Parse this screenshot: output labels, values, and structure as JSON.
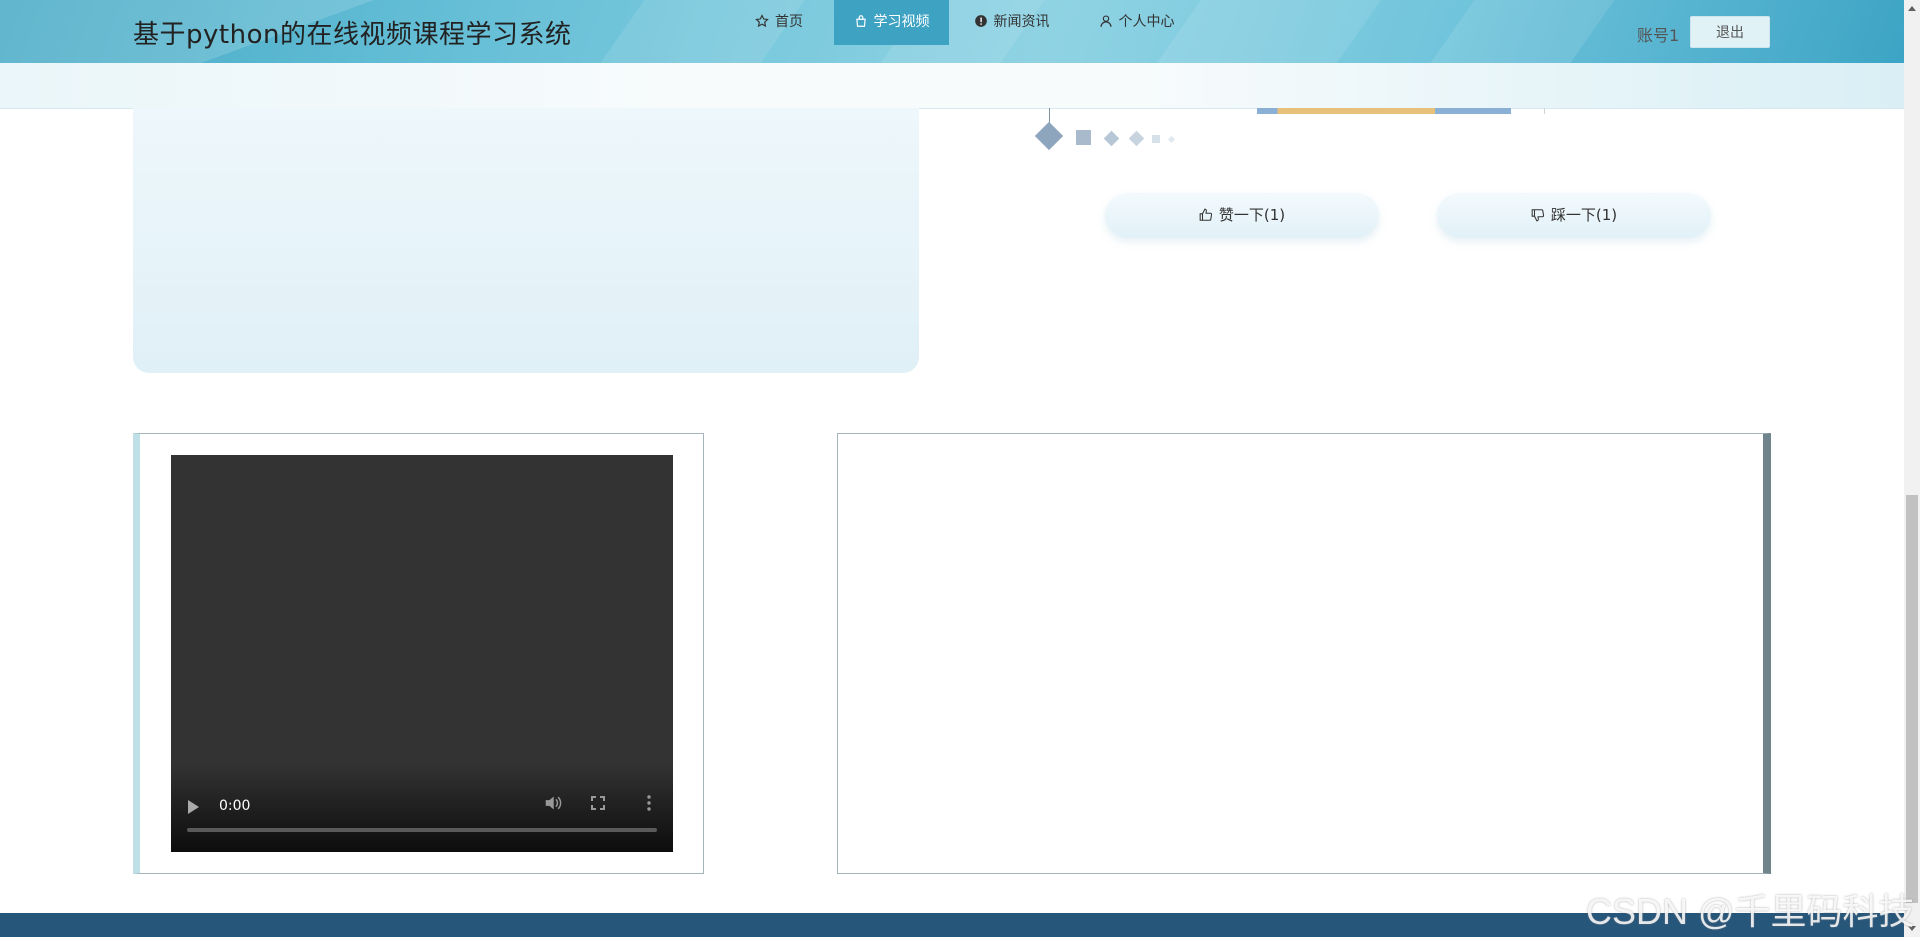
{
  "header": {
    "site_title": "基于python的在线视频课程学习系统",
    "account_label": "账号1",
    "logout_label": "退出"
  },
  "nav": {
    "items": [
      {
        "label": "首页",
        "icon": "star-icon",
        "active": false
      },
      {
        "label": "学习视频",
        "icon": "bag-icon",
        "active": true
      },
      {
        "label": "新闻资讯",
        "icon": "info-icon",
        "active": false
      },
      {
        "label": "个人中心",
        "icon": "user-icon",
        "active": false
      }
    ]
  },
  "votes": {
    "like_label": "赞一下(1)",
    "dislike_label": "踩一下(1)"
  },
  "video": {
    "current_time": "0:00"
  },
  "watermark": "CSDN @千里码科技",
  "colors": {
    "nav_active": "#3ea2c3",
    "footer": "#27567b",
    "header_gradient_start": "#46a9c5",
    "header_gradient_end": "#3da4c5"
  }
}
